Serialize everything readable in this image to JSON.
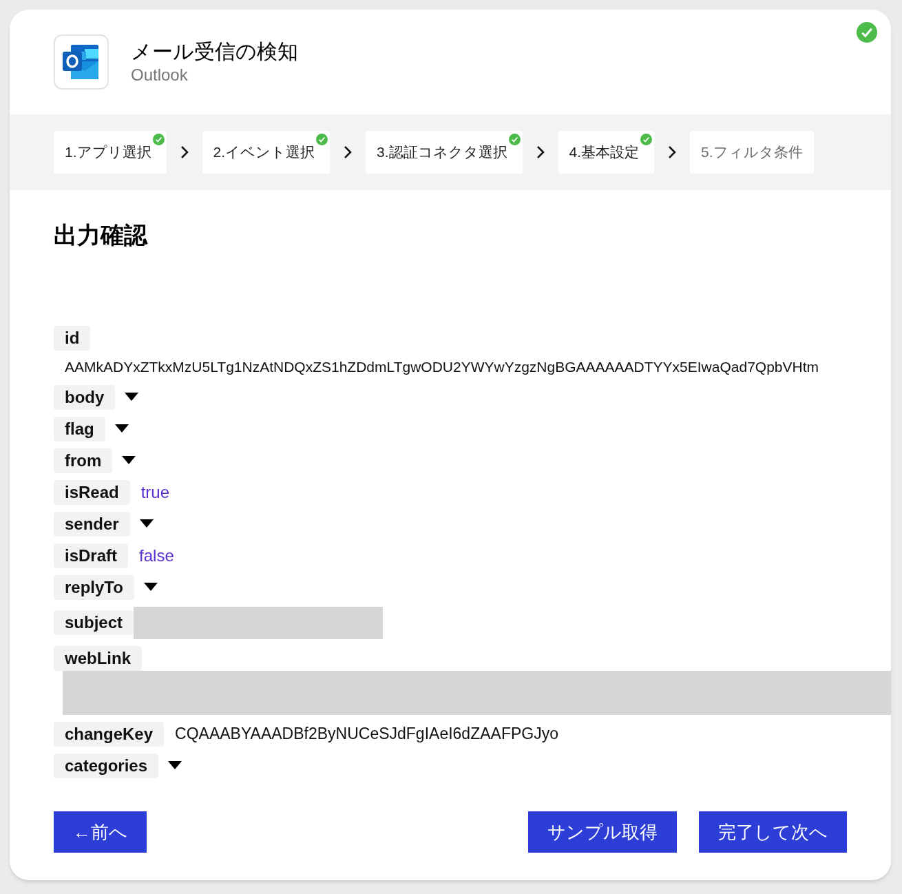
{
  "header": {
    "title": "メール受信の検知",
    "subtitle": "Outlook",
    "completed": true
  },
  "steps": [
    {
      "label": "1.アプリ選択",
      "done": true
    },
    {
      "label": "2.イベント選択",
      "done": true
    },
    {
      "label": "3.認証コネクタ選択",
      "done": true
    },
    {
      "label": "4.基本設定",
      "done": true
    },
    {
      "label": "5.フィルタ条件",
      "done": false
    }
  ],
  "section_title": "出力確認",
  "fields": [
    {
      "key": "id",
      "kind": "text-below",
      "value": "AAMkADYxZTkxMzU5LTg1NzAtNDQxZS1hZDdmLTgwODU2YWYwYzgzNgBGAAAAAADTYYx5EIwaQad7QpbVHtm"
    },
    {
      "key": "body",
      "kind": "expandable"
    },
    {
      "key": "flag",
      "kind": "expandable"
    },
    {
      "key": "from",
      "kind": "expandable"
    },
    {
      "key": "isRead",
      "kind": "literal",
      "value": "true"
    },
    {
      "key": "sender",
      "kind": "expandable"
    },
    {
      "key": "isDraft",
      "kind": "literal",
      "value": "false"
    },
    {
      "key": "replyTo",
      "kind": "expandable"
    },
    {
      "key": "subject",
      "kind": "redacted-inline"
    },
    {
      "key": "webLink",
      "kind": "redacted-below"
    },
    {
      "key": "changeKey",
      "kind": "text",
      "value": "CQAAABYAAADBf2ByNUCeSJdFgIAeI6dZAAFPGJyo"
    },
    {
      "key": "categories",
      "kind": "expandable"
    }
  ],
  "buttons": {
    "back": "←前へ",
    "sample": "サンプル取得",
    "next": "完了して次へ"
  }
}
